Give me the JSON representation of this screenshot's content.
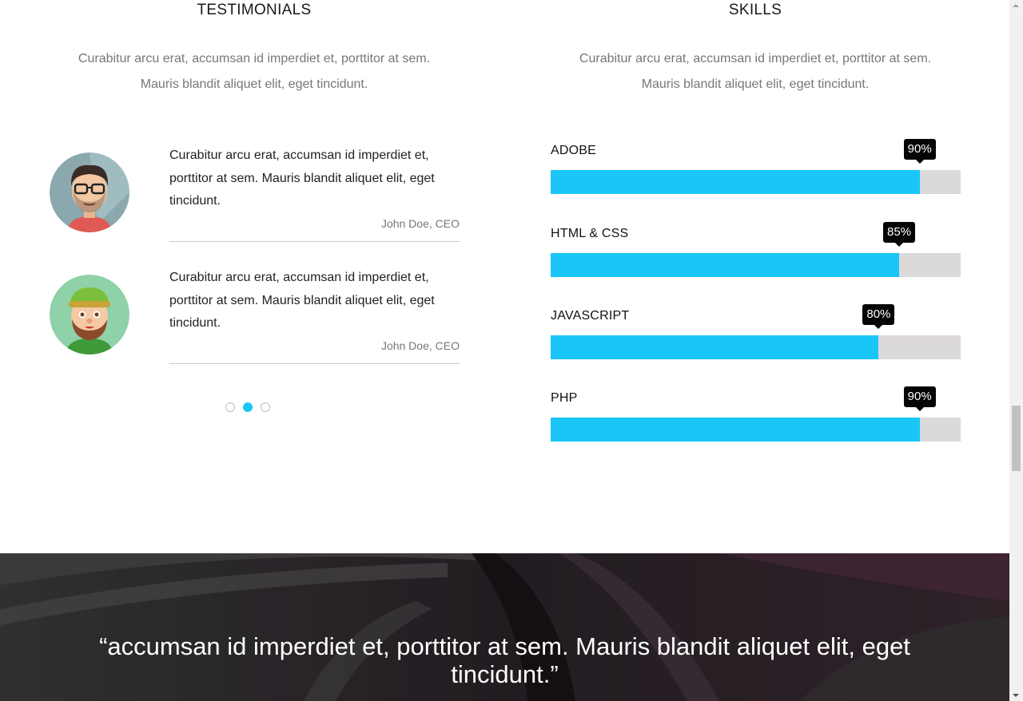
{
  "testimonials": {
    "title": "TESTIMONIALS",
    "subtitle_line1": "Curabitur arcu erat, accumsan id imperdiet et, porttitor at sem.",
    "subtitle_line2": "Mauris blandit aliquet elit, eget tincidunt.",
    "items": [
      {
        "avatar_icon": "man-with-glasses-avatar",
        "text": "Curabitur arcu erat, accumsan id imperdiet et, porttitor at sem. Mauris blandit aliquet elit, eget tincidunt.",
        "author": "John Doe, CEO"
      },
      {
        "avatar_icon": "bearded-man-with-cap-avatar",
        "text": "Curabitur arcu erat, accumsan id imperdiet et, porttitor at sem. Mauris blandit aliquet elit, eget tincidunt.",
        "author": "John Doe, CEO"
      }
    ],
    "pagination": {
      "count": 3,
      "active_index": 1
    }
  },
  "skills": {
    "title": "SKILLS",
    "subtitle_line1": "Curabitur arcu erat, accumsan id imperdiet et, porttitor at sem.",
    "subtitle_line2": "Mauris blandit aliquet elit, eget tincidunt.",
    "items": [
      {
        "label": "ADOBE",
        "percent": 90,
        "percent_label": "90%"
      },
      {
        "label": "HTML & CSS",
        "percent": 85,
        "percent_label": "85%"
      },
      {
        "label": "JAVASCRIPT",
        "percent": 80,
        "percent_label": "80%"
      },
      {
        "label": "PHP",
        "percent": 90,
        "percent_label": "90%"
      }
    ]
  },
  "banner": {
    "quote_line1": "“accumsan id imperdiet et, porttitor at sem. Mauris blandit aliquet elit, eget",
    "quote_line2": "tincidunt.”"
  },
  "colors": {
    "accent": "#19c6f7",
    "track": "#dcd9d9",
    "badge": "#050505",
    "muted_text": "#777777",
    "banner_bg": "#2c2a2c"
  }
}
